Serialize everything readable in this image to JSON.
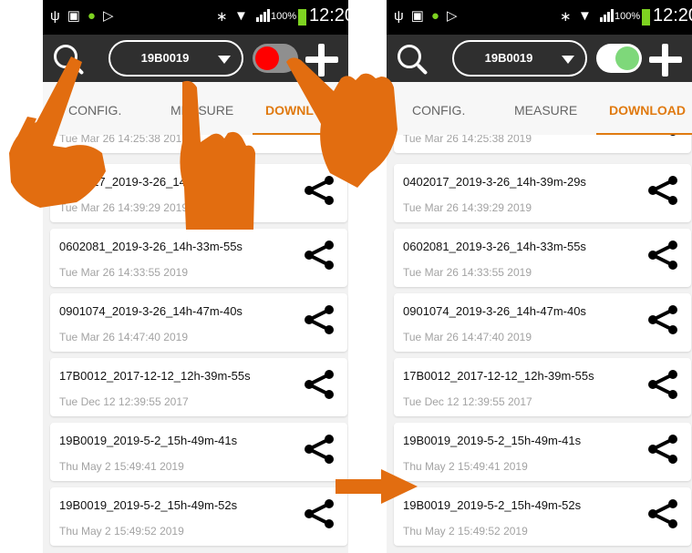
{
  "phones": [
    {
      "status_bar": {
        "battery": "100%",
        "time": "12:20"
      },
      "toolbar": {
        "device": "19B0019",
        "toggle_state": "off",
        "toggle_color": "#ff0000"
      },
      "tabs": [
        "CONFIG.",
        "MEASURE",
        "DOWNLOAD"
      ],
      "active_tab": "DOWNLOAD",
      "files": [
        {
          "name": "",
          "date": "Tue Mar 26 14:25:38 2019"
        },
        {
          "name": "0402017_2019-3-26_14h-39m-29s",
          "date": "Tue Mar 26 14:39:29 2019"
        },
        {
          "name": "0602081_2019-3-26_14h-33m-55s",
          "date": "Tue Mar 26 14:33:55 2019"
        },
        {
          "name": "0901074_2019-3-26_14h-47m-40s",
          "date": "Tue Mar 26 14:47:40 2019"
        },
        {
          "name": "17B0012_2017-12-12_12h-39m-55s",
          "date": "Tue Dec 12 12:39:55 2017"
        },
        {
          "name": "19B0019_2019-5-2_15h-49m-41s",
          "date": "Thu May 2 15:49:41 2019"
        },
        {
          "name": "19B0019_2019-5-2_15h-49m-52s",
          "date": "Thu May 2 15:49:52 2019"
        }
      ]
    },
    {
      "status_bar": {
        "battery": "100%",
        "time": "12:20"
      },
      "toolbar": {
        "device": "19B0019",
        "toggle_state": "on",
        "toggle_color": "#7ed87a"
      },
      "tabs": [
        "CONFIG.",
        "MEASURE",
        "DOWNLOAD"
      ],
      "active_tab": "DOWNLOAD",
      "files": [
        {
          "name": "",
          "date": "Tue Mar 26 14:25:38 2019"
        },
        {
          "name": "0402017_2019-3-26_14h-39m-29s",
          "date": "Tue Mar 26 14:39:29 2019"
        },
        {
          "name": "0602081_2019-3-26_14h-33m-55s",
          "date": "Tue Mar 26 14:33:55 2019"
        },
        {
          "name": "0901074_2019-3-26_14h-47m-40s",
          "date": "Tue Mar 26 14:47:40 2019"
        },
        {
          "name": "17B0012_2017-12-12_12h-39m-55s",
          "date": "Tue Dec 12 12:39:55 2017"
        },
        {
          "name": "19B0019_2019-5-2_15h-49m-41s",
          "date": "Thu May 2 15:49:41 2019"
        },
        {
          "name": "19B0019_2019-5-2_15h-49m-52s",
          "date": "Thu May 2 15:49:52 2019"
        }
      ]
    }
  ],
  "colors": {
    "accent": "#e07a10",
    "toolbar_bg": "#2f2f2f",
    "hand": "#e26d10"
  },
  "icons": [
    "usb-icon",
    "image-icon",
    "android-icon",
    "bluetooth-icon",
    "wifi-icon",
    "signal-icon",
    "battery-icon",
    "search-icon",
    "chevron-down-icon",
    "plus-icon",
    "share-icon",
    "pointing-hand-icon",
    "arrow-right-icon"
  ]
}
